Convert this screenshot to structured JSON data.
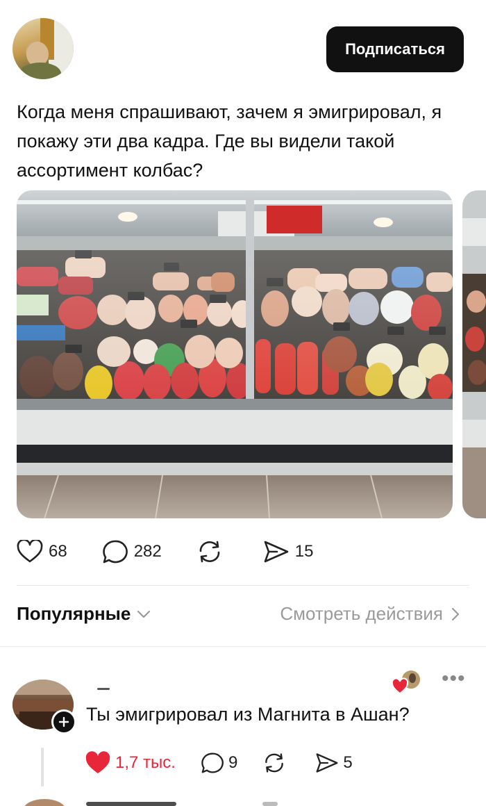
{
  "post": {
    "follow_label": "Подписаться",
    "text": "Когда меня спрашивают, зачем я эмигрировал, я покажу эти два кадра. Где вы видели такой ассортимент колбас?",
    "likes": "68",
    "comments": "282",
    "shares": "15"
  },
  "comments_bar": {
    "sort_label": "Популярные",
    "view_activity_label": "Смотреть действия"
  },
  "comment": {
    "text": "Ты эмигрировал из Магнита в Ашан?",
    "likes": "1,7 тыс.",
    "replies": "9",
    "shares": "5"
  },
  "colors": {
    "like_red": "#e8263a",
    "button_black": "#111111",
    "muted_gray": "#9a9a9a"
  },
  "icons": [
    "heart-icon",
    "comment-bubble-icon",
    "repost-icon",
    "share-send-icon",
    "chevron-down-icon",
    "chevron-right-icon",
    "plus-icon",
    "more-dots-icon"
  ]
}
